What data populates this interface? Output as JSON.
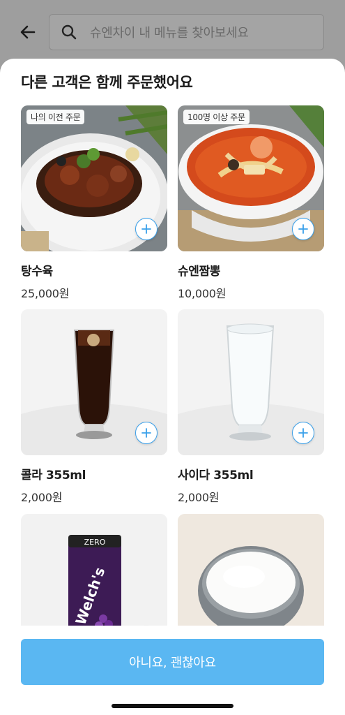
{
  "search": {
    "placeholder": "슈엔차이 내 메뉴를 찾아보세요"
  },
  "sheet": {
    "title": "다른 고객은 함께 주문했어요",
    "items": [
      {
        "name": "탕수육",
        "price": "25,000원",
        "badge": "나의 이전 주문"
      },
      {
        "name": "슈엔짬뽕",
        "price": "10,000원",
        "badge": "100명 이상 주문"
      },
      {
        "name": "콜라 355ml",
        "price": "2,000원",
        "badge": ""
      },
      {
        "name": "사이다 355ml",
        "price": "2,000원",
        "badge": ""
      },
      {
        "name": "",
        "price": "",
        "badge": ""
      },
      {
        "name": "",
        "price": "",
        "badge": ""
      }
    ],
    "cta_label": "아니요, 괜찮아요"
  },
  "colors": {
    "accent": "#5ab7f2",
    "add_border": "#3aa0ea"
  },
  "icons": {
    "back": "arrow-left-icon",
    "search": "search-icon",
    "add": "plus-icon"
  }
}
